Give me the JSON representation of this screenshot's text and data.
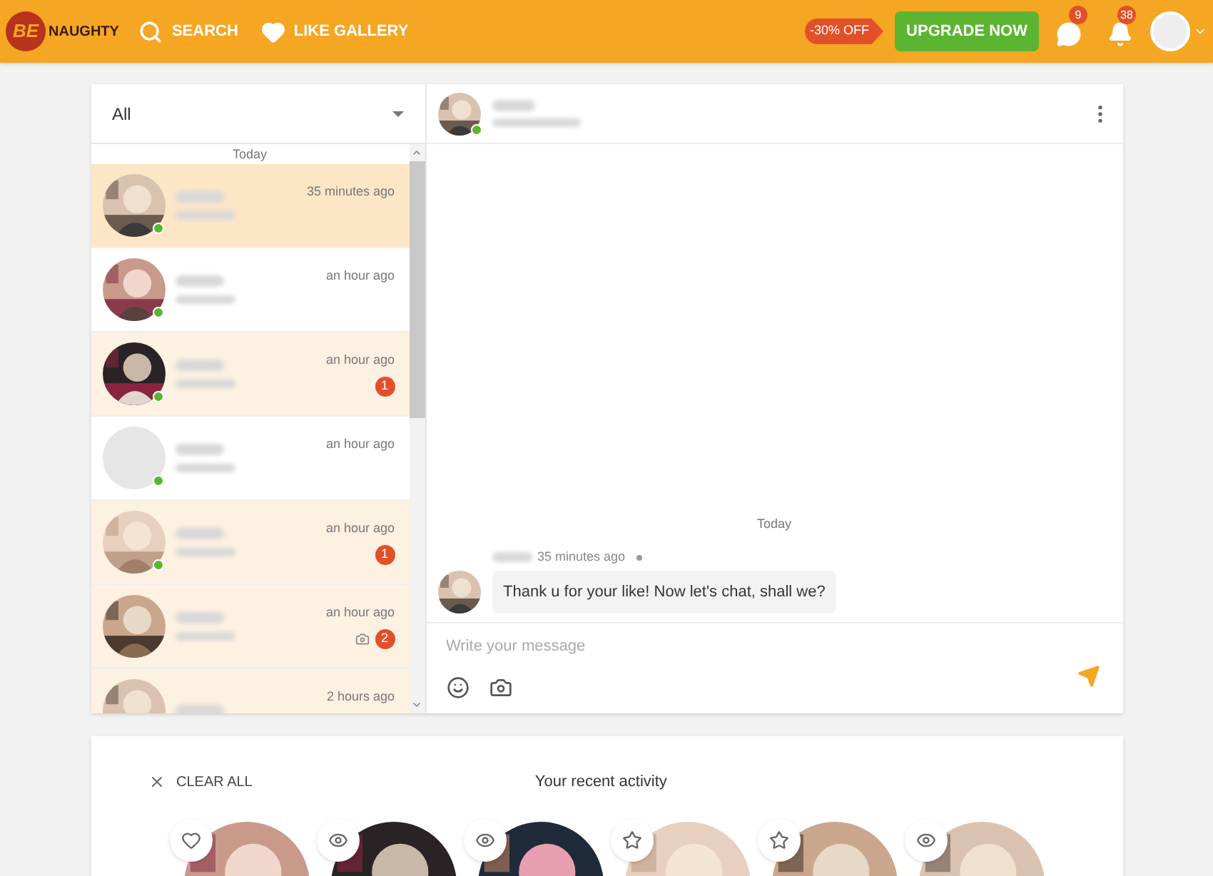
{
  "header": {
    "logo_mark": "BE",
    "logo_text": "NAUGHTY",
    "nav_links": [
      {
        "label": "SEARCH",
        "kind": "search"
      },
      {
        "label": "LIKE GALLERY",
        "kind": "like"
      }
    ],
    "promo": "-30% OFF",
    "upgrade_button": "UPGRADE NOW",
    "messages_badge": "9",
    "notifications_badge": "38"
  },
  "conversation_list": {
    "filter": {
      "value": "All"
    },
    "section": "Today",
    "items": [
      {
        "time": "35 minutes ago",
        "selected": true,
        "unread": false,
        "online": true,
        "kind": "picture"
      },
      {
        "time": "an hour ago",
        "selected": false,
        "unread": false,
        "online": true,
        "kind": "picture"
      },
      {
        "time": "an hour ago",
        "selected": false,
        "unread": true,
        "online": true,
        "kind": "picture",
        "badge": "1"
      },
      {
        "time": "an hour ago",
        "selected": false,
        "unread": false,
        "online": true,
        "kind": "blank"
      },
      {
        "time": "an hour ago",
        "selected": false,
        "unread": true,
        "online": true,
        "kind": "picture",
        "badge": "1"
      },
      {
        "time": "an hour ago",
        "selected": false,
        "unread": true,
        "online": false,
        "kind": "picture",
        "badge": "2",
        "photo": true
      },
      {
        "time": "2 hours ago",
        "selected": false,
        "unread": true,
        "online": false,
        "kind": "picture"
      }
    ]
  },
  "chat": {
    "online": true,
    "date": "Today",
    "message": {
      "time": "35 minutes ago",
      "text": "Thank u for your like! Now let's chat, shall we?"
    },
    "composer": {
      "placeholder": "Write your message"
    }
  },
  "recent_activity": {
    "clear_all": "CLEAR ALL",
    "title": "Your recent activity",
    "items": [
      {
        "kind": "like"
      },
      {
        "kind": "view"
      },
      {
        "kind": "view"
      },
      {
        "kind": "favorite"
      },
      {
        "kind": "favorite"
      },
      {
        "kind": "view"
      }
    ]
  }
}
